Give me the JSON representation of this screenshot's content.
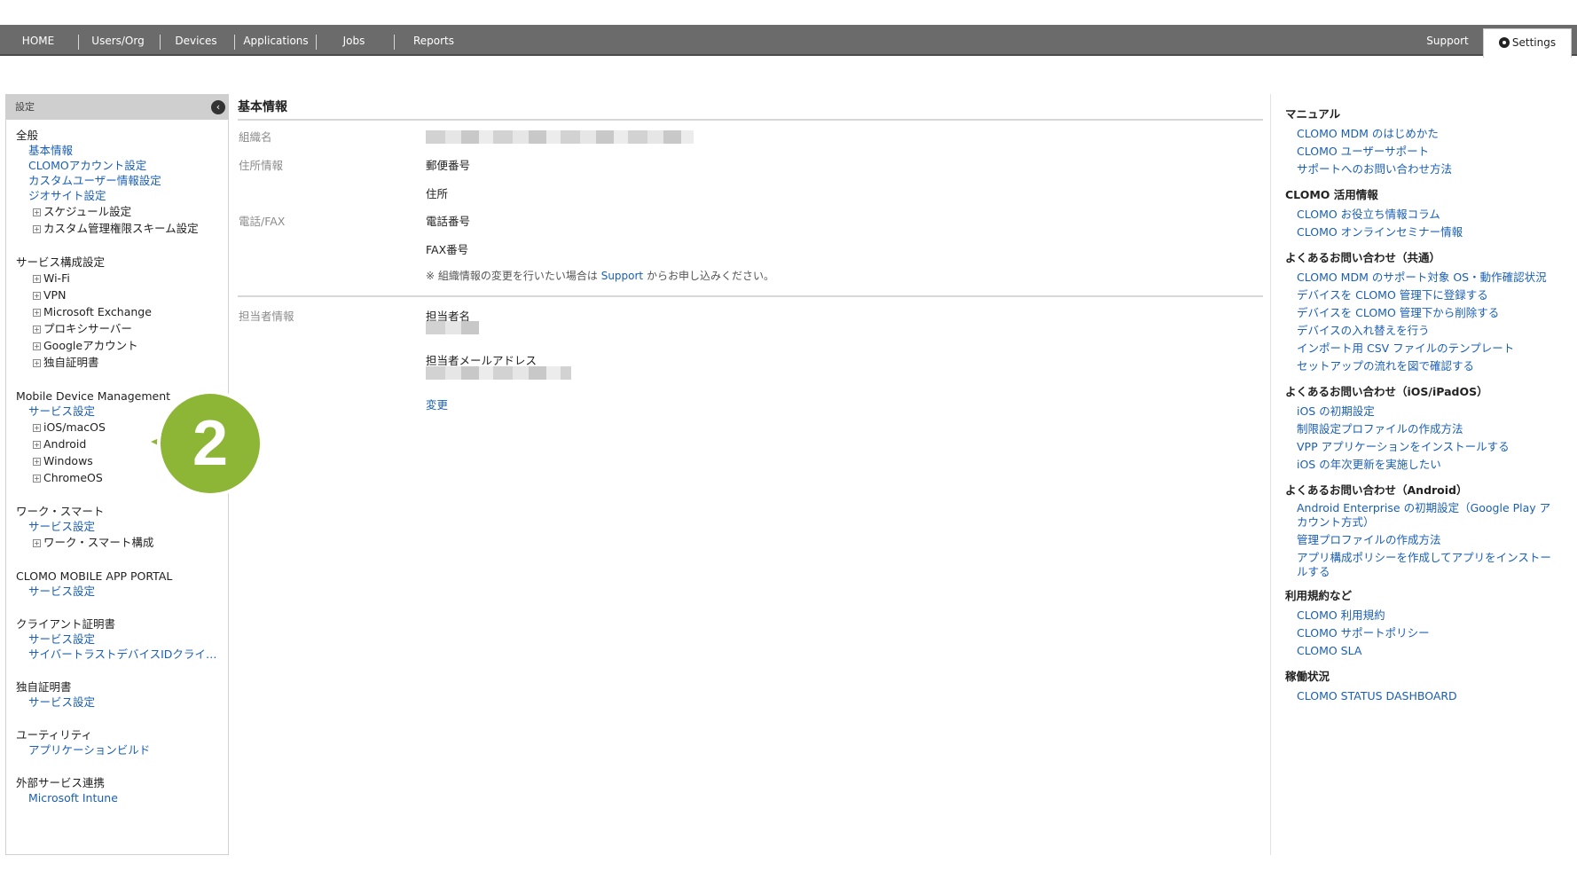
{
  "nav": {
    "items": [
      "HOME",
      "Users/Org",
      "Devices",
      "Applications",
      "Jobs",
      "Reports"
    ],
    "support": "Support",
    "settings": "Settings"
  },
  "sidebar": {
    "header": "設定",
    "collapse_glyph": "‹",
    "groups": [
      {
        "title": "全般",
        "links": [
          "基本情報",
          "CLOMOアカウント設定",
          "カスタムユーザー情報設定",
          "ジオサイト設定"
        ],
        "expandables": [
          "スケジュール設定",
          "カスタム管理権限スキーム設定"
        ]
      },
      {
        "title": "サービス構成設定",
        "links": [],
        "expandables": [
          "Wi-Fi",
          "VPN",
          "Microsoft Exchange",
          "プロキシサーバー",
          "Googleアカウント",
          "独自証明書"
        ]
      },
      {
        "title": "Mobile Device Management",
        "links": [
          "サービス設定"
        ],
        "expandables": [
          "iOS/macOS",
          "Android",
          "Windows",
          "ChromeOS"
        ]
      },
      {
        "title": "ワーク・スマート",
        "links": [
          "サービス設定"
        ],
        "expandables": [
          "ワーク・スマート構成"
        ]
      },
      {
        "title": "CLOMO MOBILE APP PORTAL",
        "links": [
          "サービス設定"
        ],
        "expandables": []
      },
      {
        "title": "クライアント証明書",
        "links": [
          "サービス設定",
          "サイバートラストデバイスIDクライアント"
        ],
        "expandables": []
      },
      {
        "title": "独自証明書",
        "links": [
          "サービス設定"
        ],
        "expandables": []
      },
      {
        "title": "ユーティリティ",
        "links": [
          "アプリケーションビルド"
        ],
        "expandables": []
      },
      {
        "title": "外部サービス連携",
        "links": [
          "Microsoft Intune"
        ],
        "expandables": []
      }
    ]
  },
  "badge": {
    "number": "2",
    "color": "#8db536"
  },
  "main": {
    "title": "基本情報",
    "org_label": "組織名",
    "address_label": "住所情報",
    "postal_label": "郵便番号",
    "address_field": "住所",
    "phone_label": "電話/FAX",
    "phone_field": "電話番号",
    "fax_field": "FAX番号",
    "note_prefix": "※ 組織情報の変更を行いたい場合は",
    "note_link": "Support",
    "note_suffix": "からお申し込みください。",
    "contact_label": "担当者情報",
    "contact_name_label": "担当者名",
    "contact_email_label": "担当者メールアドレス",
    "change_link": "変更"
  },
  "right": {
    "sections": [
      {
        "title": "マニュアル",
        "links": [
          "CLOMO MDM のはじめかた",
          "CLOMO ユーザーサポート",
          "サポートへのお問い合わせ方法"
        ]
      },
      {
        "title": "CLOMO 活用情報",
        "links": [
          "CLOMO お役立ち情報コラム",
          "CLOMO オンラインセミナー情報"
        ]
      },
      {
        "title": "よくあるお問い合わせ（共通）",
        "links": [
          "CLOMO MDM のサポート対象 OS・動作確認状況",
          "デバイスを CLOMO 管理下に登録する",
          "デバイスを CLOMO 管理下から削除する",
          "デバイスの入れ替えを行う",
          "インポート用 CSV ファイルのテンプレート",
          "セットアップの流れを図で確認する"
        ]
      },
      {
        "title": "よくあるお問い合わせ（iOS/iPadOS）",
        "links": [
          "iOS の初期設定",
          "制限設定プロファイルの作成方法",
          "VPP アプリケーションをインストールする",
          "iOS の年次更新を実施したい"
        ]
      },
      {
        "title": "よくあるお問い合わせ（Android）",
        "links": [
          "Android Enterprise の初期設定（Google Play アカウント方式）",
          "管理プロファイルの作成方法",
          "アプリ構成ポリシーを作成してアプリをインストールする"
        ]
      },
      {
        "title": "利用規約など",
        "links": [
          "CLOMO 利用規約",
          "CLOMO サポートポリシー",
          "CLOMO SLA"
        ]
      },
      {
        "title": "稼働状況",
        "links": [
          "CLOMO STATUS DASHBOARD"
        ]
      }
    ]
  }
}
